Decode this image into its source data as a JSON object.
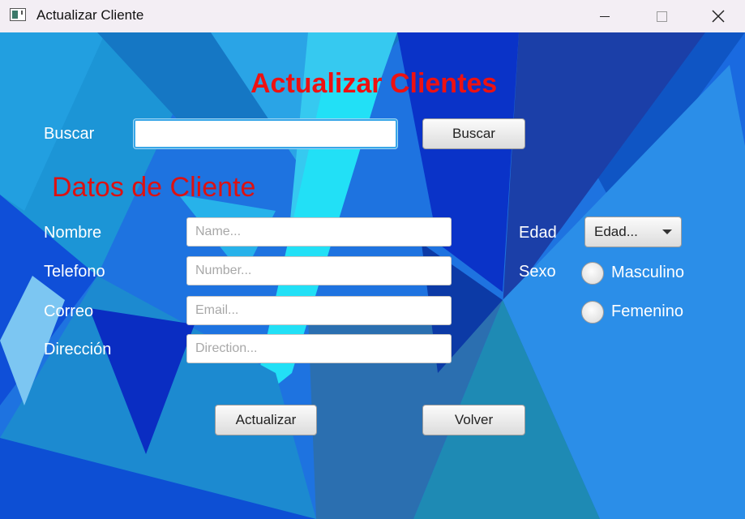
{
  "window": {
    "title": "Actualizar Cliente",
    "controls": {
      "minimize": "minimize-icon",
      "maximize": "maximize-icon",
      "close": "close-icon"
    }
  },
  "header": {
    "title": "Actualizar Clientes"
  },
  "search": {
    "label": "Buscar",
    "value": "",
    "button_label": "Buscar"
  },
  "section": {
    "title": "Datos de Cliente"
  },
  "form": {
    "name": {
      "label": "Nombre",
      "placeholder": "Name...",
      "value": ""
    },
    "phone": {
      "label": "Telefono",
      "placeholder": "Number...",
      "value": ""
    },
    "email": {
      "label": "Correo",
      "placeholder": "Email...",
      "value": ""
    },
    "address": {
      "label": "Dirección",
      "placeholder": "Direction...",
      "value": ""
    },
    "age": {
      "label": "Edad",
      "selected": "Edad..."
    },
    "sex": {
      "label": "Sexo",
      "options": [
        {
          "label": "Masculino",
          "checked": false
        },
        {
          "label": "Femenino",
          "checked": false
        }
      ]
    }
  },
  "actions": {
    "update_label": "Actualizar",
    "back_label": "Volver"
  },
  "colors": {
    "heading": "#ee1111",
    "label": "#ffffff",
    "background": "#1a6ad8",
    "focus_border": "#39a7e8"
  }
}
